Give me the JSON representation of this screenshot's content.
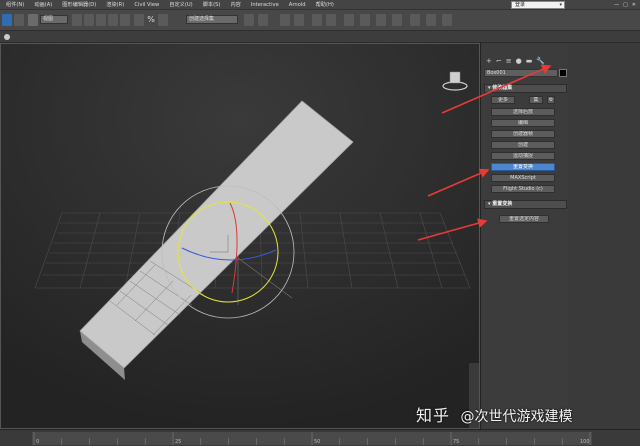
{
  "menu": [
    "组件(N)",
    "动画(A)",
    "图形编辑器(D)",
    "渲染(R)",
    "Civil View",
    "自定义(U)",
    "脚本(S)",
    "内容",
    "Interactive",
    "Arnold",
    "帮助(H)"
  ],
  "workspace": {
    "label": "登录",
    "chevron": "▾"
  },
  "window_controls": {
    "minimize": "—",
    "maximize": "□",
    "close": "✕"
  },
  "toolbar": {
    "view_dropdown": "视图",
    "selection_set": "创建选择集",
    "percent_label": "%"
  },
  "panel": {
    "tabs": [
      "+",
      "⌐",
      "≡",
      "●",
      "▬",
      "🔧"
    ],
    "object_name": "Box001",
    "modifier_rollout": "▾ 修改器集",
    "more_button": "更多",
    "sets_button": "集",
    "configure_icon": "⚙",
    "modifier_buttons": [
      "选择后放",
      "编缉",
      "创建器帧",
      "创建",
      "运动捕捉",
      "重置变换",
      "MAXScript",
      "Flight Studio (c)"
    ],
    "active_index": 5,
    "transform_rollout": "▾ 重置变换",
    "reset_selected_button": "重置选定内容"
  },
  "timeline": {
    "ticks": [
      "0",
      "25",
      "50",
      "75",
      "100"
    ]
  },
  "watermark": {
    "logo": "知乎",
    "handle": "@次世代游戏建模"
  },
  "colors": {
    "arrow": "#e83b36",
    "active_button": "#4c86cf",
    "gizmo_yellow": "#e4e43a",
    "gizmo_red": "#d63a3a",
    "gizmo_blue": "#3a5ad8"
  }
}
